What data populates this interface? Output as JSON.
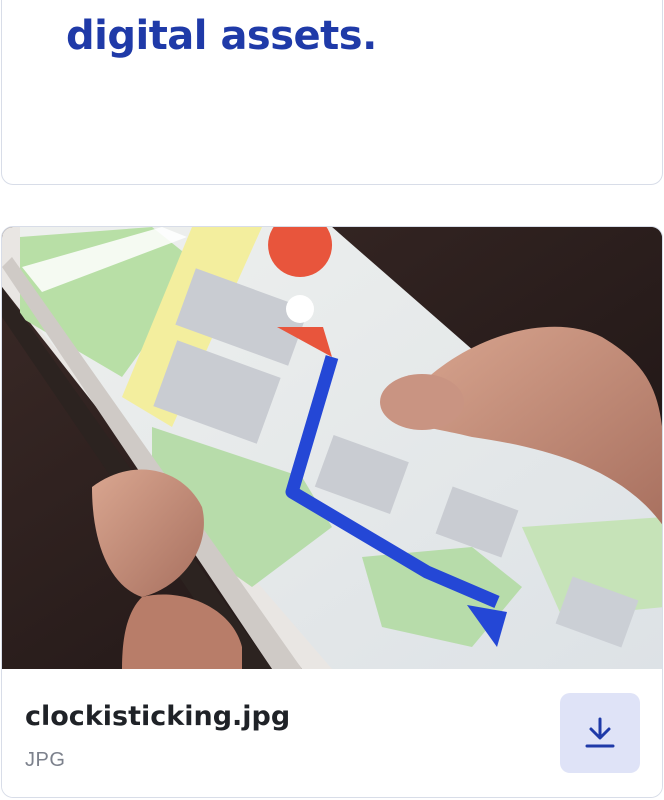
{
  "header_card": {
    "headline_tail": "digital assets."
  },
  "asset": {
    "filename": "clockisticking.jpg",
    "filetype": "JPG",
    "image_alt": "Hand holding a smartphone showing a map with a route",
    "download_icon": "download-icon"
  },
  "colors": {
    "headline": "#1f3aa8",
    "button_bg": "#dfe3f7",
    "icon": "#1f3aa8",
    "route": "#2447d6",
    "pin": "#e8553c"
  }
}
